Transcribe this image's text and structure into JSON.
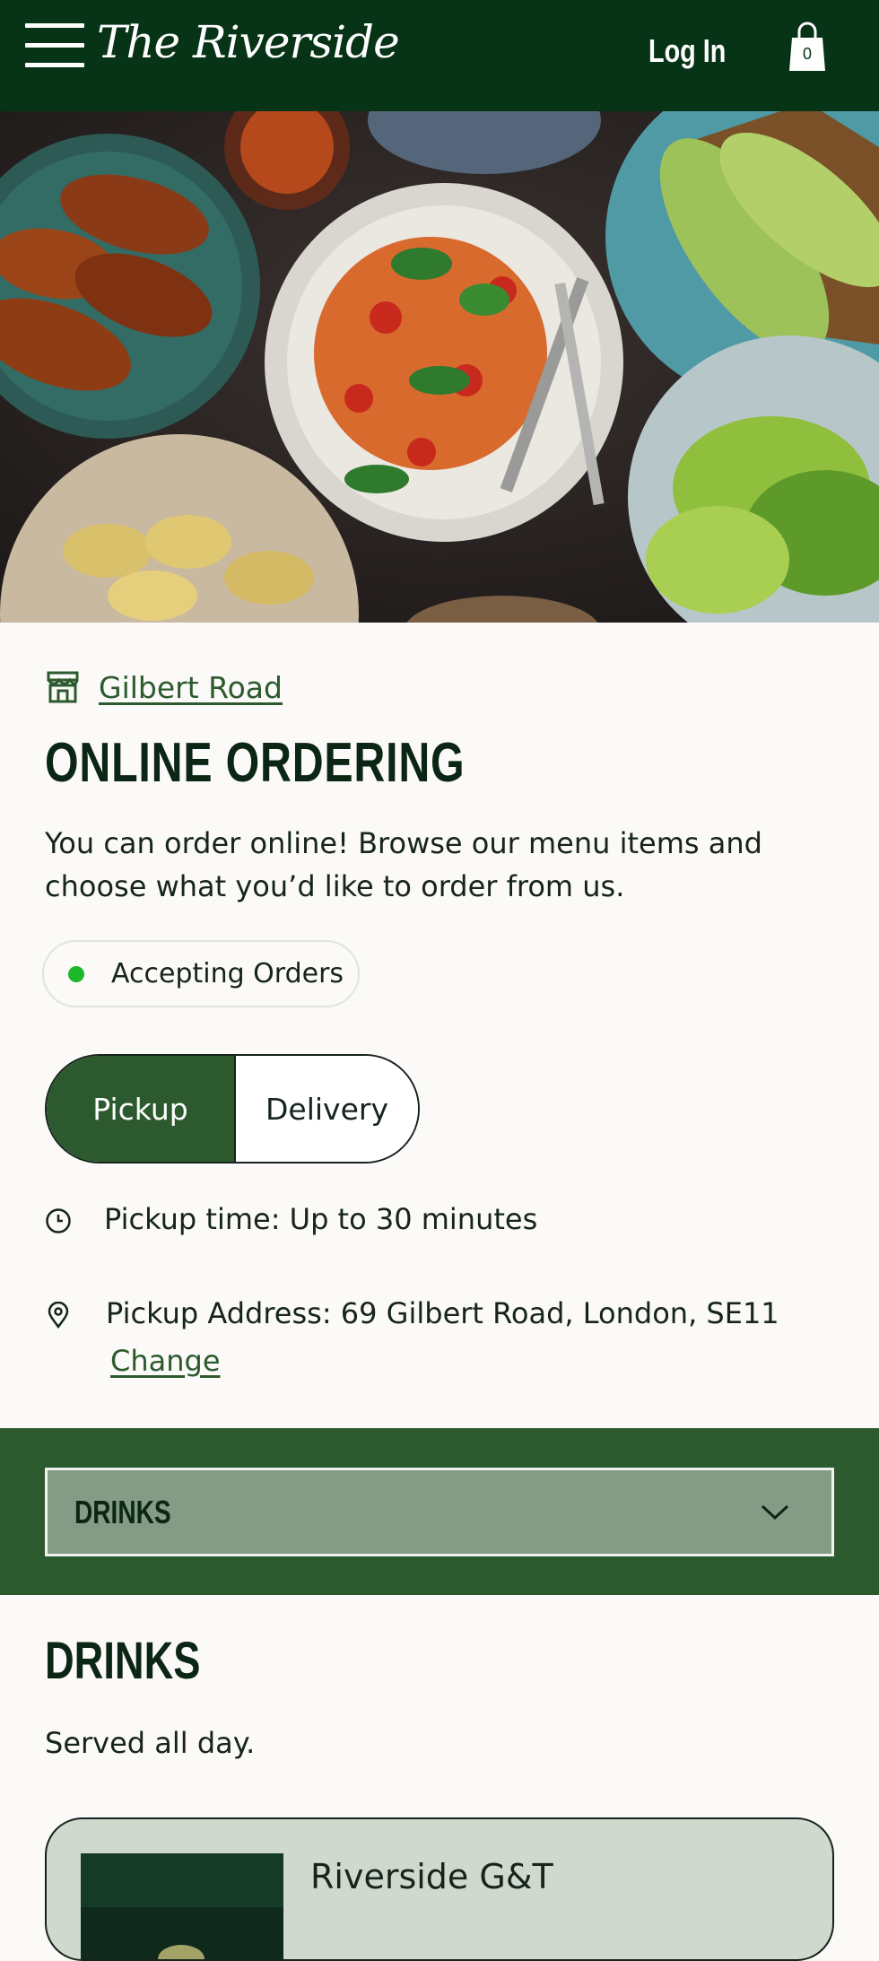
{
  "header": {
    "brand": "The Riverside",
    "login_label": "Log In",
    "cart_count": "0",
    "background_color": "#073317"
  },
  "hero": {
    "icons": [
      "hero-food-image"
    ]
  },
  "location": {
    "name": "Gilbert Road",
    "icon": "store-icon"
  },
  "intro": {
    "title": "ONLINE ORDERING",
    "description": "You can order online! Browse our menu items and choose what you’d like to order from us."
  },
  "status": {
    "label": "Accepting Orders",
    "color": "#1cb82a"
  },
  "order_mode": {
    "options": [
      "Pickup",
      "Delivery"
    ],
    "selected": "Pickup",
    "accent_color": "#2c5a2e"
  },
  "pickup": {
    "time_text": "Pickup time: Up to 30 minutes",
    "address_text": "Pickup Address: 69 Gilbert Road, London, SE11",
    "change_label": "Change"
  },
  "category_selector": {
    "selected": "DRINKS"
  },
  "menu_section": {
    "title": "DRINKS",
    "description": "Served all day.",
    "items": [
      {
        "name": "Riverside G&T"
      }
    ]
  }
}
